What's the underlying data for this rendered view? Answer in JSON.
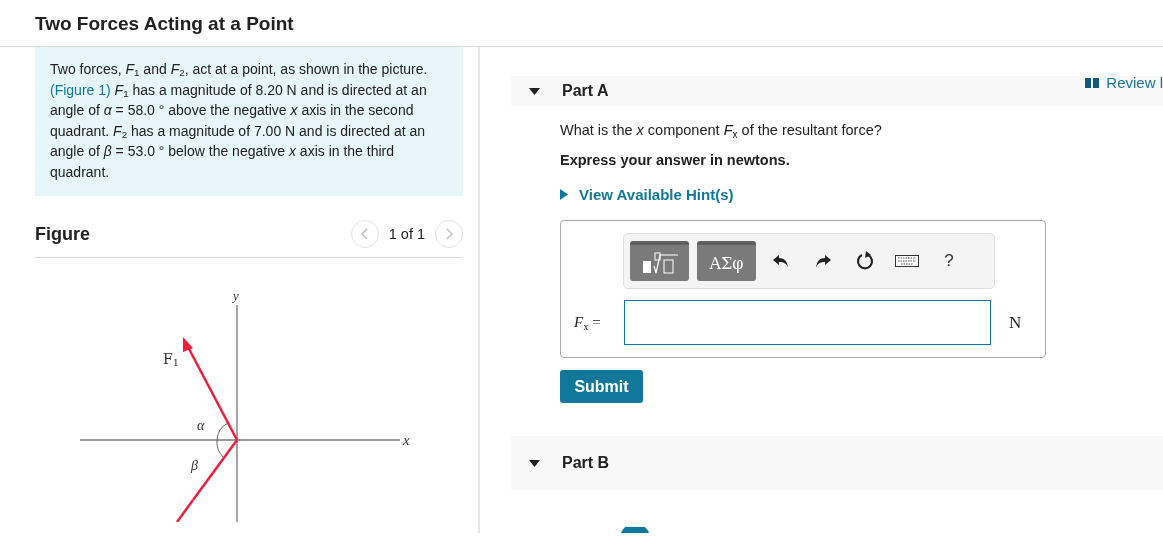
{
  "page_title": "Two Forces Acting at a Point",
  "problem": {
    "before": "Two forces, *F*$_{1}$ and *F*$_{2}$, act at a point, as shown in the picture. ",
    "link": "(Figure 1)",
    "after": " *F*$_{1}$ has a magnitude of 8.20 N and is directed at an angle of *α* = 58.0 ° above the negative *x* axis in the second quadrant. *F*$_{2}$ has a magnitude of 7.00 N and is directed at an angle of *β* = 53.0 ° below the negative *x* axis in the third quadrant."
  },
  "figure": {
    "heading": "Figure",
    "pager": "1 of 1",
    "prev_disabled": true,
    "next_disabled": true,
    "labels": {
      "y": "y",
      "x": "x",
      "f1": "F$_{1}$",
      "alpha": "α",
      "beta": "β"
    }
  },
  "review_link": "Review l",
  "parts": [
    {
      "label": "Part A",
      "expanded": true
    },
    {
      "label": "Part B",
      "expanded": true
    }
  ],
  "question": "What is the *x* component *F*$_{x}$ of the resultant force?",
  "instruction": "Express your answer in newtons.",
  "hint_link": "View Available Hint(s)",
  "toolbar": {
    "symbols": "ΑΣφ",
    "help": "?"
  },
  "answer": {
    "label": "*F*$_{x}$ =",
    "unit": "N"
  },
  "submit": "Submit"
}
